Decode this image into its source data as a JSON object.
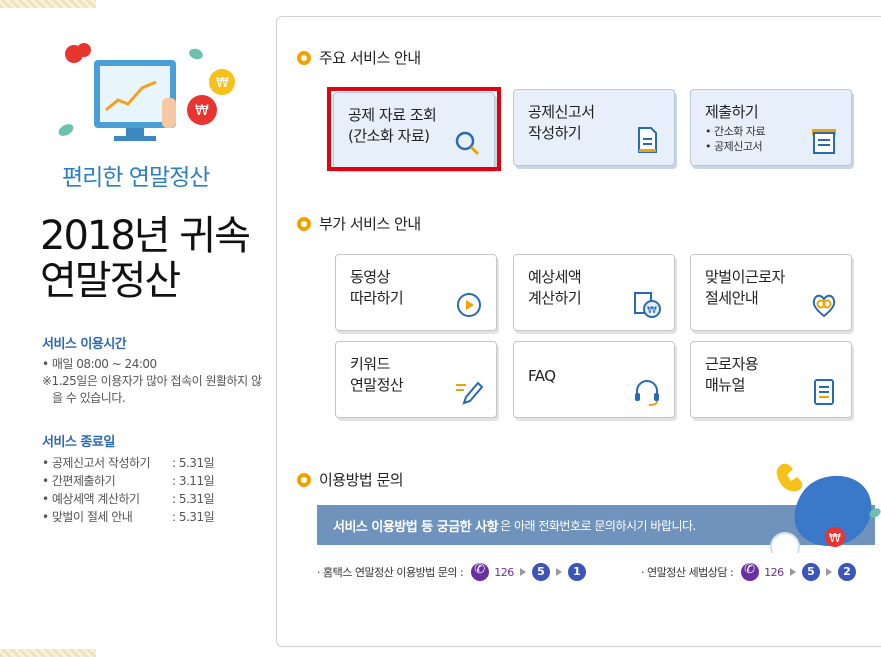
{
  "left": {
    "tagline": "편리한 연말정산",
    "title_line1": "2018년 귀속",
    "title_line2": "연말정산",
    "hours_title": "서비스 이용시간",
    "hours_line": "• 매일 08:00 ~ 24:00",
    "hours_note": "※1.25일은 이용자가 많아 접속이 원활하지 않을 수 있습니다.",
    "end_title": "서비스 종료일",
    "end_items": [
      {
        "label": "• 공제신고서 작성하기",
        "date": ": 5.31일"
      },
      {
        "label": "• 간편제출하기",
        "date": ": 3.11일"
      },
      {
        "label": "• 예상세액 계산하기",
        "date": ": 5.31일"
      },
      {
        "label": "• 맞벌이 절세 안내",
        "date": ": 5.31일"
      }
    ]
  },
  "main": {
    "section1": "주요 서비스 안내",
    "section2": "부가 서비스 안내",
    "section3": "이용방법 문의",
    "main_services": [
      {
        "line1": "공제 자료 조회",
        "line2": "(간소화 자료)",
        "icon": "magnifier-icon"
      },
      {
        "line1": "공제신고서",
        "line2": "작성하기",
        "icon": "document-icon"
      },
      {
        "line1": "제출하기",
        "sub1": "• 간소화 자료",
        "sub2": "• 공제신고서",
        "icon": "submit-tray-icon"
      }
    ],
    "extra_services": [
      {
        "line1": "동영상",
        "line2": "따라하기",
        "icon": "play-icon"
      },
      {
        "line1": "예상세액",
        "line2": "계산하기",
        "icon": "calculator-money-icon"
      },
      {
        "line1": "맞벌이근로자",
        "line2": "절세안내",
        "icon": "couple-rings-icon"
      },
      {
        "line1": "키워드",
        "line2": "연말정산",
        "icon": "pencil-list-icon"
      },
      {
        "line1": "FAQ",
        "line2": "",
        "icon": "headset-icon"
      },
      {
        "line1": "근로자용",
        "line2": "매뉴얼",
        "icon": "manual-icon"
      }
    ],
    "banner_bold": "서비스 이용방법 등 궁금한 사항",
    "banner_rest": "은 아래 전화번호로 문의하시기 바랍니다.",
    "contact1_label": "· 홈택스 연말정산 이용방법 문의 :",
    "contact1_tel": "126",
    "contact1_steps": [
      "5",
      "1"
    ],
    "contact2_label": "· 연말정산 세법상담 :",
    "contact2_tel": "126",
    "contact2_steps": [
      "5",
      "2"
    ]
  },
  "colors": {
    "accent": "#2c7fc5",
    "highlight": "#e3000f",
    "banner": "#6f93bd",
    "dot": "#f0a300"
  }
}
